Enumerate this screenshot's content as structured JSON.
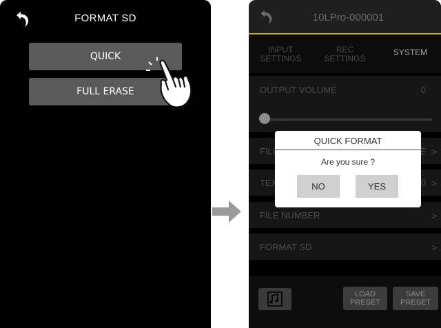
{
  "left_screen": {
    "title": "FORMAT SD",
    "quick_button": "QUICK",
    "full_erase_button": "FULL ERASE"
  },
  "right_screen": {
    "title": "10LPro-000001",
    "tabs": [
      {
        "line1": "INPUT",
        "line2": "SETTINGS"
      },
      {
        "line1": "REC",
        "line2": "SETTINGS"
      },
      {
        "line1": "SYSTEM",
        "line2": ""
      }
    ],
    "selected_tab": "SYSTEM",
    "output_volume": {
      "label": "OUTPUT VOLUME",
      "value": "0",
      "slider_level": 0
    },
    "rows": {
      "file_name": {
        "label": "FILI",
        "value": "E"
      },
      "text": {
        "label": "TEX",
        "value": "0"
      },
      "file_number": {
        "label": "FILE NUMBER"
      },
      "format_sd": {
        "label": "FORMAT SD"
      }
    },
    "bottom": {
      "load_preset": {
        "line1": "LOAD",
        "line2": "PRESET"
      },
      "save_preset": {
        "line1": "SAVE",
        "line2": "PRESET"
      }
    },
    "dialog": {
      "title": "QUICK FORMAT",
      "message": "Are you sure ?",
      "no": "NO",
      "yes": "YES"
    }
  },
  "colors": {
    "accent": "#c8b030",
    "button_gray": "#5a5a5a",
    "arrow": "#9a9a9a"
  },
  "icons": [
    "back-arrow-icon",
    "pointing-hand-icon",
    "right-arrow-icon",
    "music-folder-icon",
    "chevron-right-icon"
  ]
}
